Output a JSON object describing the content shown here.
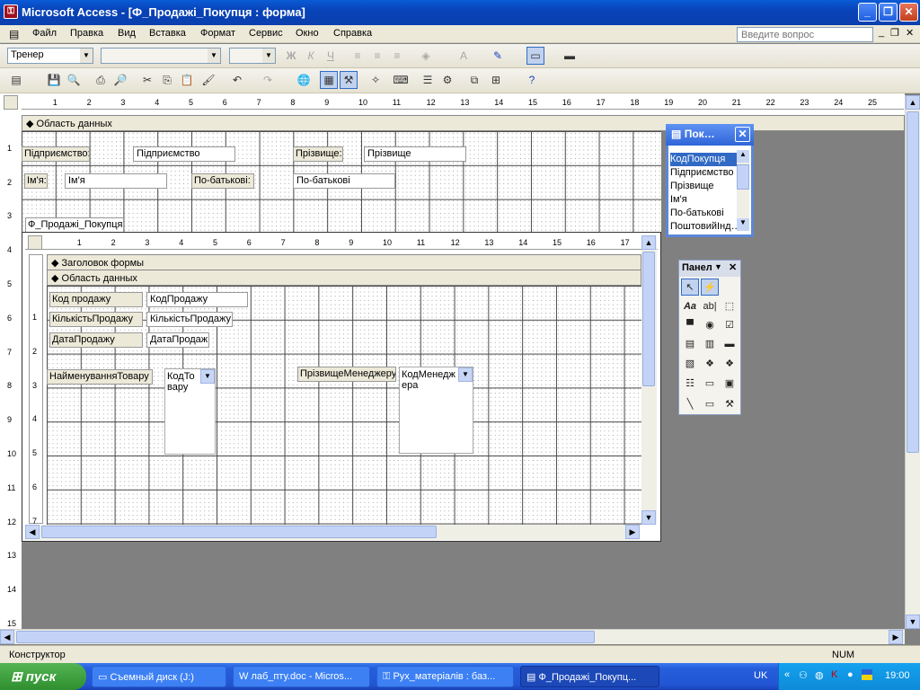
{
  "titlebar": {
    "title": "Microsoft Access - [Ф_Продажі_Покупця : форма]"
  },
  "menu": {
    "items": [
      "Файл",
      "Правка",
      "Вид",
      "Вставка",
      "Формат",
      "Сервис",
      "Окно",
      "Справка"
    ],
    "ask_placeholder": "Введите вопрос"
  },
  "format_toolbar": {
    "object_combo": "Тренер",
    "bold": "Ж",
    "italic": "К",
    "underline": "Ч",
    "letter_a": "А"
  },
  "ruler": {
    "top_ticks": [
      "1",
      "2",
      "3",
      "4",
      "5",
      "6",
      "7",
      "8",
      "9",
      "10",
      "11",
      "12",
      "13",
      "14",
      "15",
      "16",
      "17",
      "18",
      "19",
      "20",
      "21",
      "22",
      "23",
      "24",
      "25"
    ],
    "left_ticks": [
      "1",
      "2",
      "3",
      "4",
      "5",
      "6",
      "7",
      "8",
      "9",
      "10",
      "11",
      "12",
      "13",
      "14",
      "15"
    ]
  },
  "main_form": {
    "data_section": "Область данных",
    "controls": [
      {
        "label": "Підприємство:",
        "field": "Підприємство"
      },
      {
        "label": "Прізвище:",
        "field": "Прізвище"
      },
      {
        "label": "Ім'я:",
        "field": "Ім'я"
      },
      {
        "label": "По-батькові:",
        "field": "По-батькові"
      }
    ],
    "subform_label": "Ф_Продажі_Покупця"
  },
  "subform": {
    "top_ticks": [
      "1",
      "2",
      "3",
      "4",
      "5",
      "6",
      "7",
      "8",
      "9",
      "10",
      "11",
      "12",
      "13",
      "14",
      "15",
      "16",
      "17"
    ],
    "left_ticks": [
      "1",
      "2",
      "3",
      "4",
      "5",
      "6",
      "7"
    ],
    "header_section": "Заголовок формы",
    "data_section": "Область данных",
    "controls": [
      {
        "label": "Код продажу",
        "field": "КодПродажу"
      },
      {
        "label": "КількістьПродажу",
        "field": "КількістьПродажу"
      },
      {
        "label": "ДатаПродажу",
        "field": "ДатаПродаж"
      }
    ],
    "list1": {
      "label": "НайменуванняТовару",
      "value": "КодТовару"
    },
    "list2": {
      "label": "ПрізвищеМенеджеру",
      "value": "КодМенеджера"
    }
  },
  "field_list": {
    "title": "Пок…",
    "items": [
      "КодПокупця",
      "Підприємство",
      "Прізвище",
      "Ім'я",
      "По-батькові",
      "ПоштовийІнд…"
    ]
  },
  "toolbox": {
    "title": "Панел",
    "tools": [
      "Aa",
      "ab|"
    ]
  },
  "status": {
    "left": "Конструктор",
    "num": "NUM"
  },
  "taskbar": {
    "start": "пуск",
    "tasks": [
      "Съемный диск (J:)",
      "лаб_пту.doc - Micros...",
      "Рух_матеріалів : баз...",
      "Ф_Продажі_Покупц..."
    ],
    "lang": "UK",
    "clock": "19:00"
  }
}
